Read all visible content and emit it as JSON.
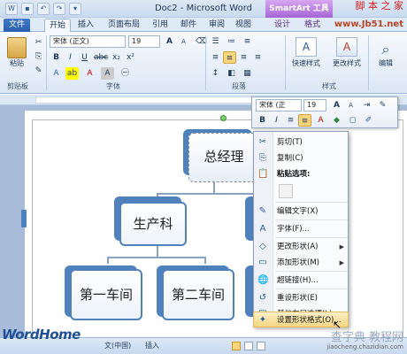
{
  "window": {
    "title": "Doc2 - Microsoft Word",
    "context_tab": "SmartArt 工具"
  },
  "watermark": {
    "site": "脚 本 之 家",
    "url": "www.Jb51.net",
    "bottom_text": "查字典 教程网",
    "bottom_url": "jiaocheng.chazidian.com"
  },
  "tabs": [
    "文件",
    "开始",
    "插入",
    "页面布局",
    "引用",
    "邮件",
    "审阅",
    "视图",
    "设计",
    "格式"
  ],
  "ribbon": {
    "font_name": "宋体 (正文)",
    "font_size": "19",
    "groups": [
      "剪贴板",
      "字体",
      "段落",
      "样式"
    ],
    "paste_label": "粘贴",
    "quick_styles": "快速样式",
    "change_styles": "更改样式",
    "edit": "编辑"
  },
  "mini_toolbar": {
    "font": "宋体 (正",
    "size": "19"
  },
  "org_chart": {
    "nodes": [
      "总经理",
      "生产科",
      "第一车间",
      "第二车间"
    ]
  },
  "context_menu": {
    "items": [
      {
        "label": "剪切(T)",
        "icon": "cut-icon",
        "glyph": "✂"
      },
      {
        "label": "复制(C)",
        "icon": "copy-icon",
        "glyph": "⎘"
      },
      {
        "label": "粘贴选项:",
        "icon": "paste-icon",
        "glyph": "📋"
      },
      {
        "label": "编辑文字(X)",
        "icon": "edit-text-icon",
        "glyph": "✎"
      },
      {
        "label": "字体(F)...",
        "icon": "font-icon",
        "glyph": "A"
      },
      {
        "label": "更改形状(A)",
        "icon": "change-shape-icon",
        "glyph": "◇"
      },
      {
        "label": "添加形状(M)",
        "icon": "add-shape-icon",
        "glyph": "▭"
      },
      {
        "label": "超链接(H)...",
        "icon": "hyperlink-icon",
        "glyph": "🌐"
      },
      {
        "label": "重设形状(E)",
        "icon": "reset-shape-icon",
        "glyph": "↺"
      },
      {
        "label": "其他布局选项(L)...",
        "icon": "layout-options-icon",
        "glyph": "▤"
      },
      {
        "label": "设置形状格式(O)...",
        "icon": "format-shape-icon",
        "glyph": "✦"
      }
    ]
  },
  "statusbar": {
    "logo": "WordHome",
    "lang": "文(中国)",
    "mode": "插入"
  }
}
